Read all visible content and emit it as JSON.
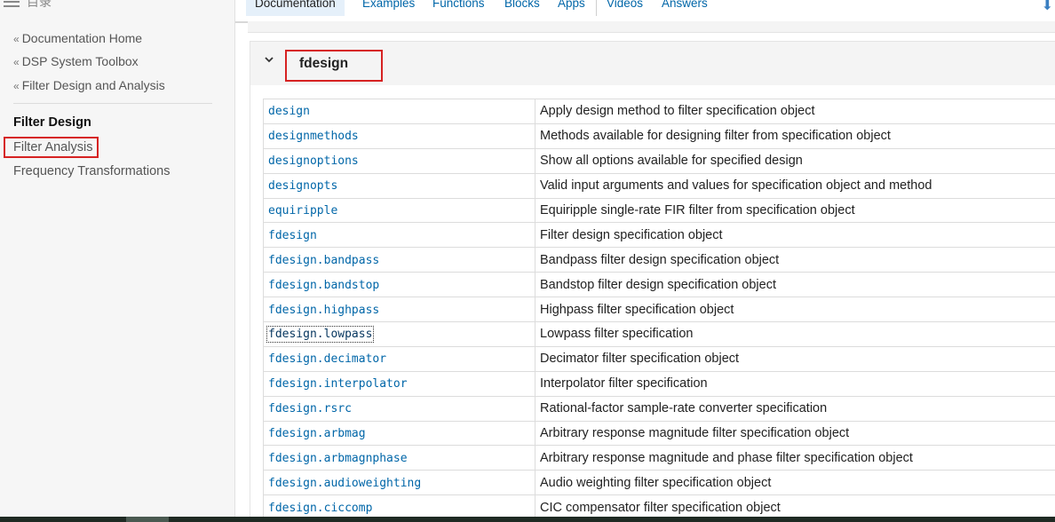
{
  "sidebar": {
    "toc_label": "目录",
    "crumbs": [
      "Documentation Home",
      "DSP System Toolbox",
      "Filter Design and Analysis"
    ],
    "crumb_prefix": "«",
    "items": [
      {
        "label": "Filter Design",
        "active": true
      },
      {
        "label": "Filter Analysis",
        "active": false
      },
      {
        "label": "Frequency Transformations",
        "active": false
      }
    ]
  },
  "topnav": {
    "tabs": [
      "Documentation",
      "Examples",
      "Functions",
      "Blocks",
      "Apps",
      "Videos",
      "Answers"
    ],
    "active_tab": "Documentation"
  },
  "section": {
    "title": "fdesign",
    "rows": [
      {
        "name": "design",
        "desc": "Apply design method to filter specification object"
      },
      {
        "name": "designmethods",
        "desc": "Methods available for designing filter from specification object"
      },
      {
        "name": "designoptions",
        "desc": "Show all options available for specified design"
      },
      {
        "name": "designopts",
        "desc": "Valid input arguments and values for specification object and method"
      },
      {
        "name": "equiripple",
        "desc": "Equiripple single-rate FIR filter from specification object"
      },
      {
        "name": "fdesign",
        "desc": "Filter design specification object"
      },
      {
        "name": "fdesign.bandpass",
        "desc": "Bandpass filter design specification object"
      },
      {
        "name": "fdesign.bandstop",
        "desc": "Bandstop filter design specification object"
      },
      {
        "name": "fdesign.highpass",
        "desc": "Highpass filter specification object"
      },
      {
        "name": "fdesign.lowpass",
        "desc": "Lowpass filter specification"
      },
      {
        "name": "fdesign.decimator",
        "desc": "Decimator filter specification object"
      },
      {
        "name": "fdesign.interpolator",
        "desc": "Interpolator filter specification"
      },
      {
        "name": "fdesign.rsrc",
        "desc": "Rational-factor sample-rate converter specification"
      },
      {
        "name": "fdesign.arbmag",
        "desc": "Arbitrary response magnitude filter specification object"
      },
      {
        "name": "fdesign.arbmagnphase",
        "desc": "Arbitrary response magnitude and phase filter specification object"
      },
      {
        "name": "fdesign.audioweighting",
        "desc": "Audio weighting filter specification object"
      },
      {
        "name": "fdesign.ciccomp",
        "desc": "CIC compensator filter specification object"
      }
    ]
  },
  "colors": {
    "link": "#0066a8",
    "highlight": "#d62222",
    "active_tab_bg": "#e5f0fa"
  }
}
